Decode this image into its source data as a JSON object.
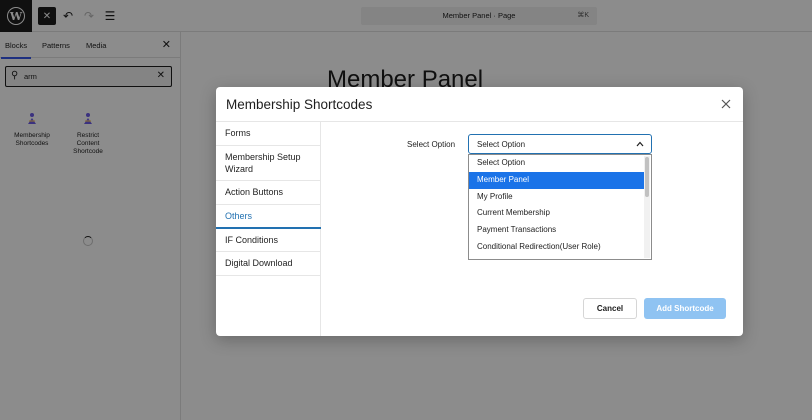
{
  "topbar": {
    "document_title": "Member Panel · Page",
    "shortcut": "⌘K"
  },
  "sidebar": {
    "tabs": [
      {
        "label": "Blocks",
        "active": true
      },
      {
        "label": "Patterns",
        "active": false
      },
      {
        "label": "Media",
        "active": false
      }
    ],
    "search": {
      "value": "arm",
      "placeholder": "Search"
    },
    "blocks": [
      {
        "label_lines": [
          "Membership",
          "Shortcodes"
        ],
        "icon": "membership-block-icon"
      },
      {
        "label_lines": [
          "Restrict",
          "Content",
          "Shortcode"
        ],
        "icon": "restrict-content-block-icon"
      }
    ]
  },
  "canvas": {
    "page_title": "Member Panel"
  },
  "modal": {
    "title": "Membership Shortcodes",
    "nav": [
      {
        "label": "Forms",
        "active": false
      },
      {
        "label": "Membership Setup Wizard",
        "active": false
      },
      {
        "label": "Action Buttons",
        "active": false
      },
      {
        "label": "Others",
        "active": true
      },
      {
        "label": "IF Conditions",
        "active": false
      },
      {
        "label": "Digital Download",
        "active": false
      }
    ],
    "field_label": "Select Option",
    "select_value": "Select Option",
    "options": [
      {
        "label": "Select Option",
        "highlighted": false
      },
      {
        "label": "Member Panel",
        "highlighted": true
      },
      {
        "label": "My Profile",
        "highlighted": false
      },
      {
        "label": "Current Membership",
        "highlighted": false
      },
      {
        "label": "Payment Transactions",
        "highlighted": false
      },
      {
        "label": "Conditional Redirection(User Role)",
        "highlighted": false
      }
    ],
    "cancel_label": "Cancel",
    "add_label": "Add Shortcode"
  },
  "colors": {
    "accent": "#2271b1",
    "highlight": "#1a73e8",
    "add_button_disabled": "#8fc3f2",
    "brand_dark": "#1e1e1e"
  }
}
